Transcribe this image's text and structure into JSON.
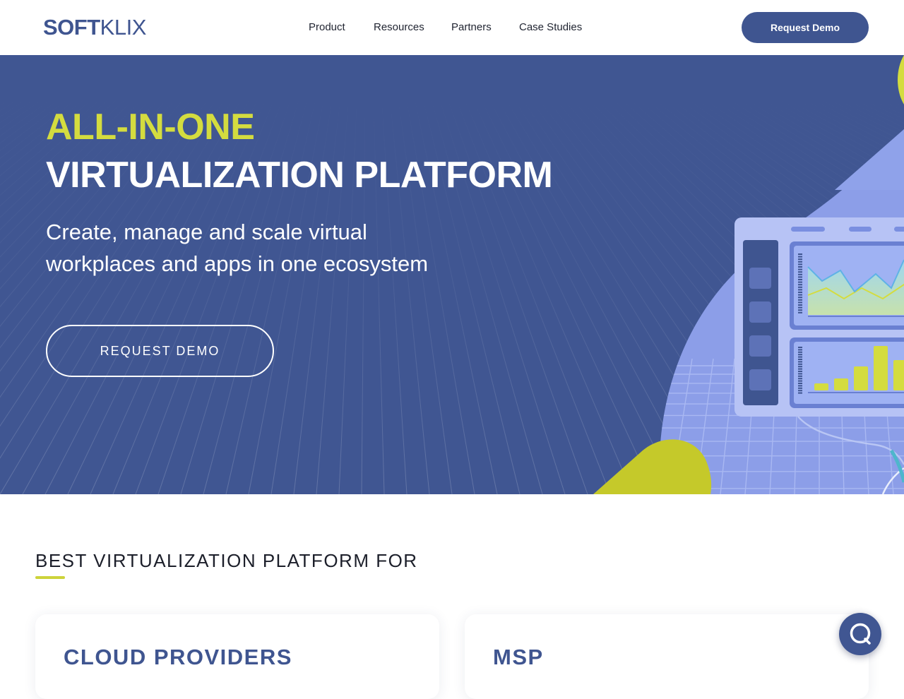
{
  "header": {
    "logo_bold": "SOFT",
    "logo_thin": "KLIX",
    "nav": [
      "Product",
      "Resources",
      "Partners",
      "Case Studies"
    ],
    "cta_label": "Request Demo"
  },
  "hero": {
    "title_line1": "ALL-IN-ONE",
    "title_line2": "VIRTUALIZATION PLATFORM",
    "subtitle": "Create, manage and scale virtual workplaces and apps in one ecosystem",
    "cta_label": "REQUEST DEMO"
  },
  "section": {
    "title": "BEST VIRTUALIZATION PLATFORM FOR",
    "cards": [
      "CLOUD PROVIDERS",
      "MSP"
    ]
  },
  "colors": {
    "brand": "#3f5590",
    "hero_bg": "#405692",
    "accent_yellow": "#d4dc3f",
    "illustration_light": "#8c9ee8"
  },
  "chat": {
    "icon": "chat-icon"
  }
}
